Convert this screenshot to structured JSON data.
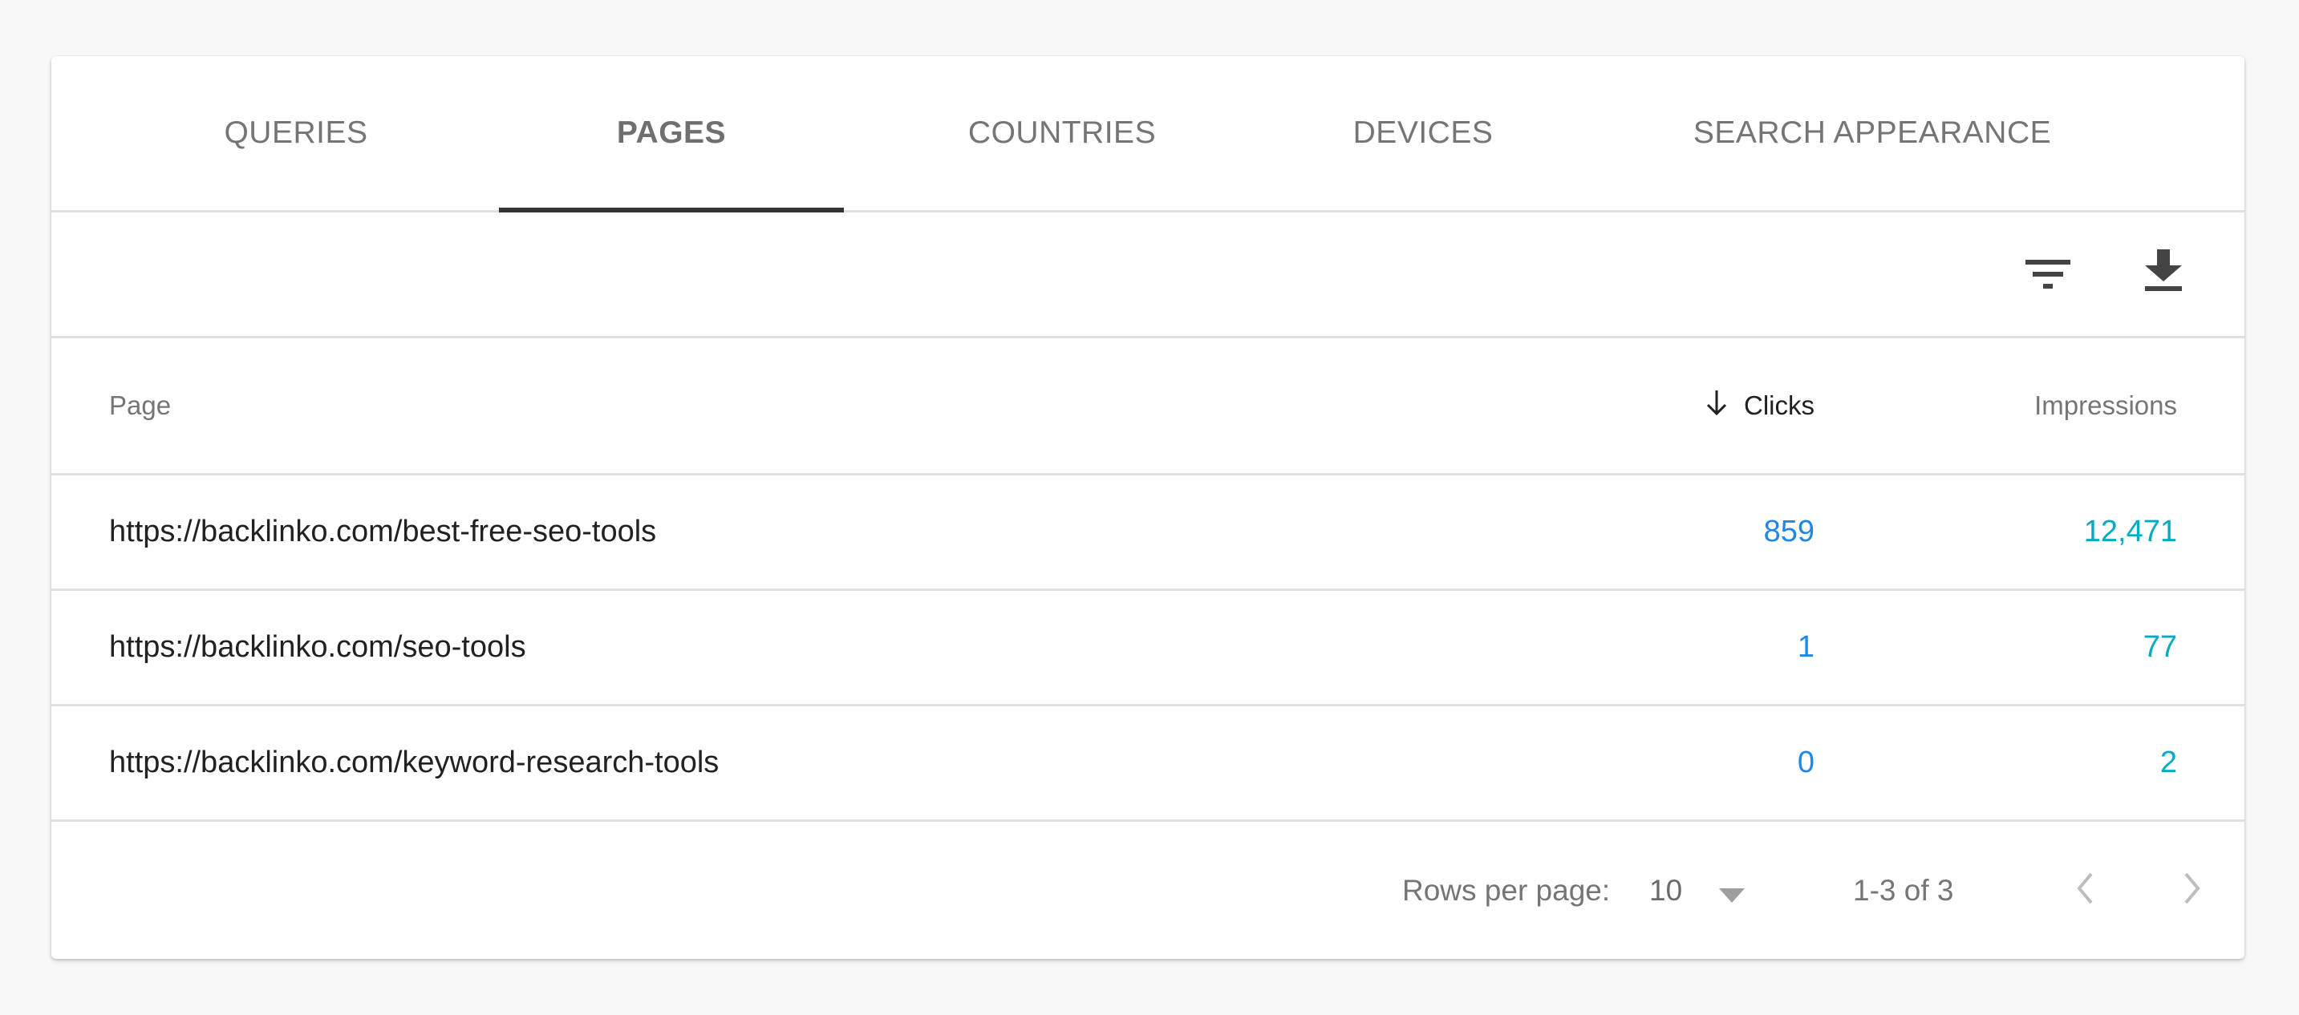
{
  "tabs": [
    {
      "label": "QUERIES",
      "active": false
    },
    {
      "label": "PAGES",
      "active": true
    },
    {
      "label": "COUNTRIES",
      "active": false
    },
    {
      "label": "DEVICES",
      "active": false
    },
    {
      "label": "SEARCH APPEARANCE",
      "active": false
    }
  ],
  "toolbar": {
    "filter_icon": "filter-icon",
    "download_icon": "download-icon"
  },
  "table": {
    "columns": {
      "page": "Page",
      "clicks": "Clicks",
      "impressions": "Impressions"
    },
    "sort": {
      "column": "clicks",
      "direction": "descending",
      "icon": "arrow-down-icon"
    },
    "rows": [
      {
        "page": "https://backlinko.com/best-free-seo-tools",
        "clicks": "859",
        "impressions": "12,471"
      },
      {
        "page": "https://backlinko.com/seo-tools",
        "clicks": "1",
        "impressions": "77"
      },
      {
        "page": "https://backlinko.com/keyword-research-tools",
        "clicks": "0",
        "impressions": "2"
      }
    ]
  },
  "footer": {
    "rows_per_page_label": "Rows per page:",
    "rows_per_page_value": "10",
    "range": "1-3 of 3"
  },
  "colors": {
    "clicks": "#1e88e5",
    "impressions": "#00acc1",
    "active_tab_indicator": "#333333"
  }
}
